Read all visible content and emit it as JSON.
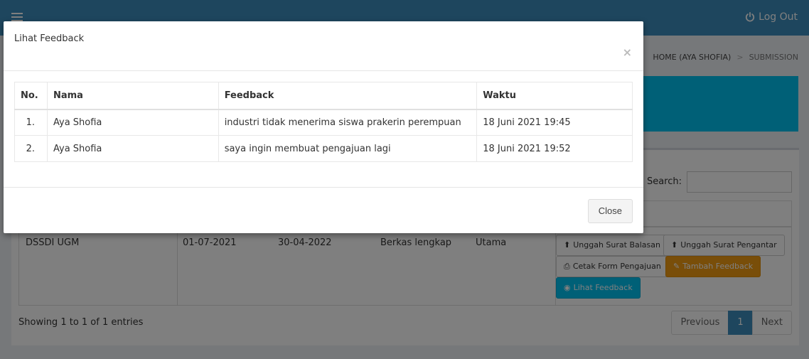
{
  "topbar": {
    "logout_label": "Log Out",
    "accent": "#3c8dbc"
  },
  "breadcrumb": {
    "home": "HOME (AYA SHOFIA)",
    "separator": ">",
    "current": "SUBMISSION"
  },
  "panel": {
    "search_label": "Search:",
    "row": {
      "instansi": "DSSDI UGM",
      "tanggal_mulai": "01-07-2021",
      "tanggal_selesai": "30-04-2022",
      "status": "Berkas lengkap",
      "jenis": "Utama"
    },
    "actions": {
      "unggah_balasan": "Unggah Surat Balasan",
      "unggah_pengantar": "Unggah Surat Pengantar",
      "cetak_form": "Cetak Form Pengajuan",
      "tambah_feedback": "Tambah Feedback",
      "lihat_feedback": "Lihat Feedback"
    },
    "showing": "Showing 1 to 1 of 1 entries",
    "pagination": {
      "previous": "Previous",
      "current_page": "1",
      "next": "Next"
    }
  },
  "modal": {
    "title": "Lihat Feedback",
    "close_symbol": "×",
    "columns": [
      "No.",
      "Nama",
      "Feedback",
      "Waktu"
    ],
    "rows": [
      {
        "no": "1.",
        "nama": "Aya Shofia",
        "feedback": "industri tidak menerima siswa prakerin perempuan",
        "waktu": "18 Juni 2021 19:45"
      },
      {
        "no": "2.",
        "nama": "Aya Shofia",
        "feedback": "saya ingin membuat pengajuan lagi",
        "waktu": "18 Juni 2021 19:52"
      }
    ],
    "close_button": "Close"
  },
  "icons": {
    "menu": "hamburger-icon",
    "logout": "power-icon",
    "upload": "upload-icon",
    "print": "print-icon",
    "edit": "edit-icon",
    "view": "eye-icon"
  }
}
